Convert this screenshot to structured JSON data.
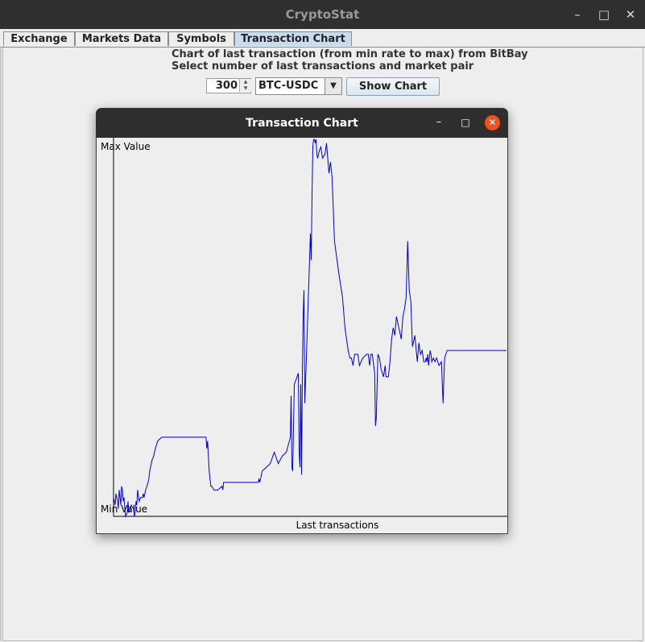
{
  "app": {
    "title": "CryptoStat"
  },
  "window_controls": {
    "minimize": "–",
    "maximize": "□",
    "close": "✕"
  },
  "tabs": [
    {
      "label": "Exchange"
    },
    {
      "label": "Markets Data"
    },
    {
      "label": "Symbols"
    },
    {
      "label": "Transaction Chart"
    }
  ],
  "panel": {
    "line1": "Chart of last transaction (from min rate to max) from BitBay",
    "line2": "Select number of last transactions and market pair",
    "count_value": "300",
    "pair_value": "BTC-USDC",
    "show_button": "Show Chart"
  },
  "chart_window": {
    "title": "Transaction Chart",
    "controls": {
      "minimize": "–",
      "maximize": "□",
      "close": "✕"
    }
  },
  "chart_data": {
    "type": "line",
    "title": "",
    "xlabel": "Last transactions",
    "ylabel": "",
    "y_max_label": "Max Value",
    "y_min_label": "Min Value",
    "line_color": "#0000cc",
    "x": [
      0,
      2,
      3,
      5,
      6,
      7,
      8,
      9,
      10,
      11,
      12,
      13,
      14,
      15,
      17,
      18,
      19,
      22,
      25,
      26,
      27,
      28,
      29,
      30,
      32,
      34,
      36,
      37,
      38,
      40,
      43,
      44,
      45,
      46,
      47,
      48,
      50,
      52,
      55,
      60,
      70,
      80,
      90,
      100,
      110,
      115,
      116,
      117,
      118,
      119,
      120,
      121,
      122,
      125,
      130,
      135,
      136,
      137,
      138,
      140,
      145,
      150,
      155,
      160,
      165,
      170,
      175,
      180,
      181,
      182,
      183,
      185,
      190,
      195,
      200,
      205,
      210,
      215,
      220,
      221,
      222,
      223,
      225,
      230,
      231,
      232,
      233,
      234,
      235,
      236,
      237,
      238,
      240,
      243,
      245,
      246,
      247,
      248,
      249,
      250,
      251,
      252,
      253,
      254,
      256,
      258,
      260,
      263,
      265,
      268,
      270,
      272,
      275,
      280,
      285,
      288,
      290,
      292,
      294,
      296,
      298,
      300,
      302,
      304,
      306,
      310,
      315,
      317,
      318,
      319,
      320,
      322,
      325,
      326,
      327,
      329,
      331,
      333,
      336,
      338,
      339,
      340,
      342,
      344,
      346,
      348,
      350,
      352,
      355,
      358,
      360,
      362,
      364,
      366,
      368,
      370,
      372,
      375,
      378,
      380,
      382,
      384,
      386,
      388,
      389,
      390,
      391,
      392,
      394,
      395,
      396,
      398,
      400,
      402,
      405,
      408,
      410,
      412,
      415,
      418,
      420,
      422,
      425,
      428,
      430,
      432,
      434,
      435,
      436,
      440,
      445,
      450,
      455,
      460,
      465,
      470,
      475,
      478,
      480,
      483,
      485,
      487,
      489
    ],
    "y": [
      0.05,
      0.03,
      0.06,
      0.04,
      0.02,
      0.07,
      0.05,
      0.03,
      0.08,
      0.07,
      0.04,
      0.05,
      0.02,
      0.0,
      0.01,
      0.04,
      0.01,
      0.03,
      0.02,
      0.0,
      0.01,
      0.04,
      0.03,
      0.07,
      0.04,
      0.05,
      0.05,
      0.06,
      0.05,
      0.07,
      0.09,
      0.1,
      0.12,
      0.13,
      0.14,
      0.15,
      0.16,
      0.18,
      0.2,
      0.21,
      0.21,
      0.21,
      0.21,
      0.21,
      0.21,
      0.21,
      0.18,
      0.2,
      0.16,
      0.12,
      0.1,
      0.08,
      0.08,
      0.07,
      0.07,
      0.08,
      0.07,
      0.09,
      0.09,
      0.09,
      0.09,
      0.09,
      0.09,
      0.09,
      0.09,
      0.09,
      0.09,
      0.09,
      0.1,
      0.09,
      0.1,
      0.12,
      0.13,
      0.14,
      0.17,
      0.14,
      0.16,
      0.17,
      0.21,
      0.32,
      0.13,
      0.12,
      0.35,
      0.38,
      0.17,
      0.13,
      0.35,
      0.11,
      0.38,
      0.53,
      0.6,
      0.3,
      0.42,
      0.62,
      0.75,
      0.68,
      0.85,
      0.98,
      1.0,
      1.0,
      0.99,
      1.0,
      0.96,
      0.95,
      0.97,
      0.98,
      0.95,
      0.96,
      0.99,
      0.91,
      0.94,
      0.9,
      0.73,
      0.65,
      0.58,
      0.5,
      0.47,
      0.44,
      0.42,
      0.42,
      0.4,
      0.43,
      0.43,
      0.43,
      0.4,
      0.42,
      0.43,
      0.43,
      0.41,
      0.4,
      0.43,
      0.43,
      0.38,
      0.24,
      0.26,
      0.43,
      0.42,
      0.39,
      0.37,
      0.4,
      0.37,
      0.37,
      0.37,
      0.41,
      0.47,
      0.5,
      0.48,
      0.53,
      0.5,
      0.47,
      0.53,
      0.55,
      0.58,
      0.73,
      0.6,
      0.57,
      0.45,
      0.48,
      0.41,
      0.46,
      0.43,
      0.44,
      0.41,
      0.41,
      0.42,
      0.41,
      0.43,
      0.4,
      0.44,
      0.43,
      0.41,
      0.42,
      0.41,
      0.42,
      0.4,
      0.41,
      0.3,
      0.42,
      0.44,
      0.44,
      0.44,
      0.44,
      0.44,
      0.44,
      0.44,
      0.44,
      0.44,
      0.44,
      0.44,
      0.44,
      0.44,
      0.44,
      0.44,
      0.44,
      0.44,
      0.44,
      0.44,
      0.44,
      0.44,
      0.44,
      0.44,
      0.44,
      0.44,
      0.44,
      0.41,
      0.45,
      0.46,
      0.49,
      0.51,
      0.51
    ]
  }
}
